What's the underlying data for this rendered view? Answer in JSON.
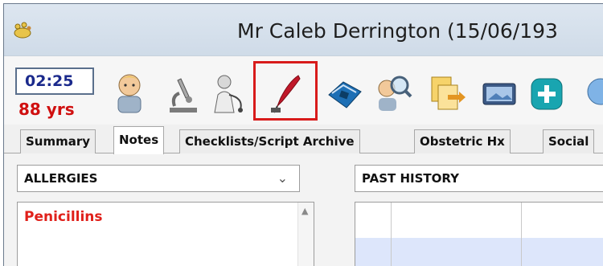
{
  "window": {
    "title": "Mr Caleb Derrington (15/06/193"
  },
  "patient_status": {
    "time": "02:25",
    "age": "88 yrs"
  },
  "toolbar": {
    "buttons": [
      {
        "icon": "patient-icon"
      },
      {
        "icon": "microscope-icon"
      },
      {
        "icon": "stethoscope-doctor-icon"
      },
      {
        "icon": "quill-pen-icon",
        "highlighted": true
      },
      {
        "icon": "telephone-icon"
      },
      {
        "icon": "magnifier-person-icon"
      },
      {
        "icon": "documents-arrow-icon"
      },
      {
        "icon": "monitor-icon"
      },
      {
        "icon": "add-icon"
      }
    ]
  },
  "tabs": [
    {
      "label": "Summary",
      "active": false
    },
    {
      "label": "Notes",
      "active": true
    },
    {
      "label": "Checklists/Script Archive",
      "active": false
    },
    {
      "label": "Obstetric Hx",
      "active": false
    },
    {
      "label": "Social",
      "active": false
    }
  ],
  "allergies": {
    "selected": "ALLERGIES",
    "items": [
      "Penicillins"
    ]
  },
  "past_history": {
    "header": "PAST HISTORY"
  },
  "colors": {
    "highlight": "#d81b1b",
    "allergy_text": "#e0201a",
    "age_text": "#d01010",
    "clock_text": "#1b2a8c"
  }
}
